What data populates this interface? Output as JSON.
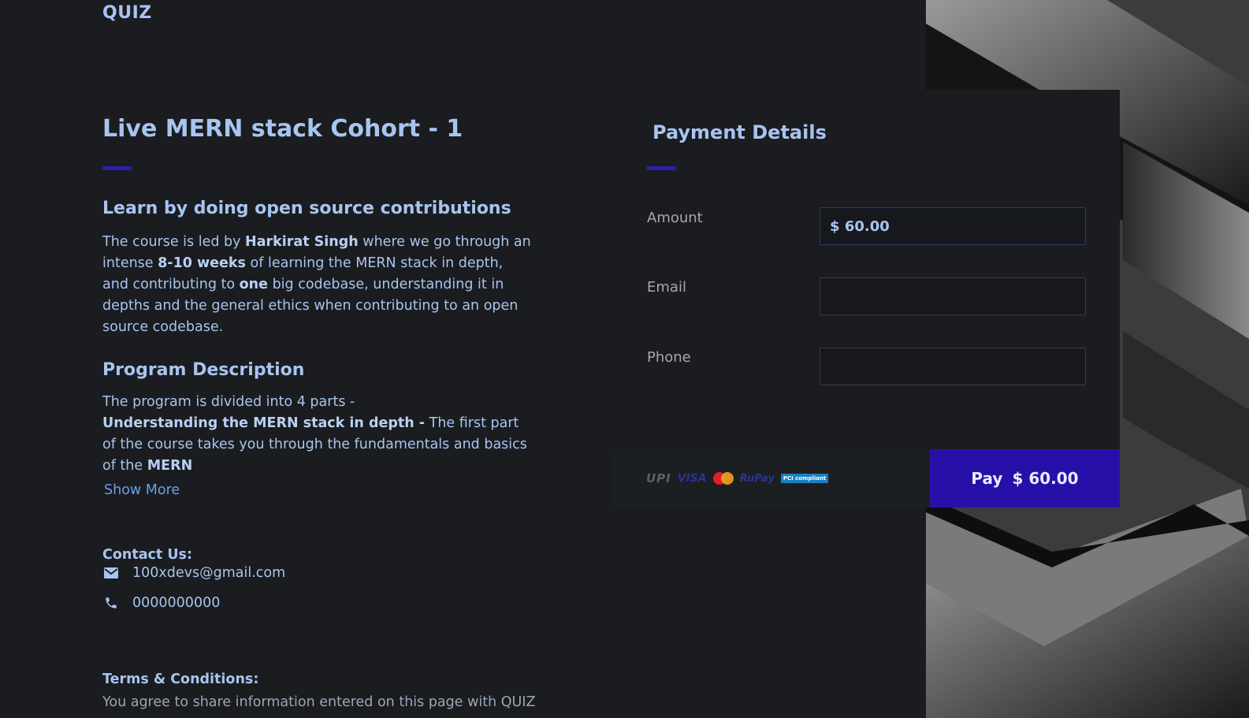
{
  "brand": "QUIZ",
  "course": {
    "title": "Live MERN stack Cohort - 1",
    "section1_heading": "Learn by doing open source contributions",
    "section1_parts": {
      "p1": "The course is led by ",
      "b1": "Harkirat Singh",
      "p2": " where we go through an intense ",
      "b2": "8-10 weeks",
      "p3": " of learning the MERN stack in depth, and contributing to ",
      "b3": "one",
      "p4": " big codebase, understanding it in depths and the general ethics when contributing to an open source codebase."
    },
    "section2_heading": "Program Description",
    "section2_intro": "The program is divided into 4 parts -",
    "section2_bold": "Understanding the MERN stack in depth -",
    "section2_text": " The first part of the course takes you through the fundamentals and basics of the ",
    "section2_bold_end": "MERN",
    "show_more": "Show More"
  },
  "contact": {
    "heading": "Contact Us:",
    "email": "100xdevs@gmail.com",
    "phone": "0000000000"
  },
  "terms": {
    "heading": "Terms & Conditions:",
    "text": "You agree to share information entered on this page with QUIZ"
  },
  "payment": {
    "title": "Payment Details",
    "fields": {
      "amount_label": "Amount",
      "amount_symbol": "$",
      "amount_value": "60.00",
      "email_label": "Email",
      "email_value": "",
      "phone_label": "Phone",
      "phone_value": ""
    },
    "logos": {
      "upi": "UPI",
      "visa": "VISA",
      "rupay": "RuPay",
      "pci": "PCI compliant"
    },
    "pay_label": "Pay",
    "pay_amount": "$ 60.00"
  },
  "colors": {
    "accent": "#2a1fb0",
    "pay_button": "#2710a8",
    "heading_text": "#a8c4f0",
    "background": "#1a1c1f"
  },
  "icons": {
    "email": "mail-icon",
    "phone": "phone-icon"
  }
}
